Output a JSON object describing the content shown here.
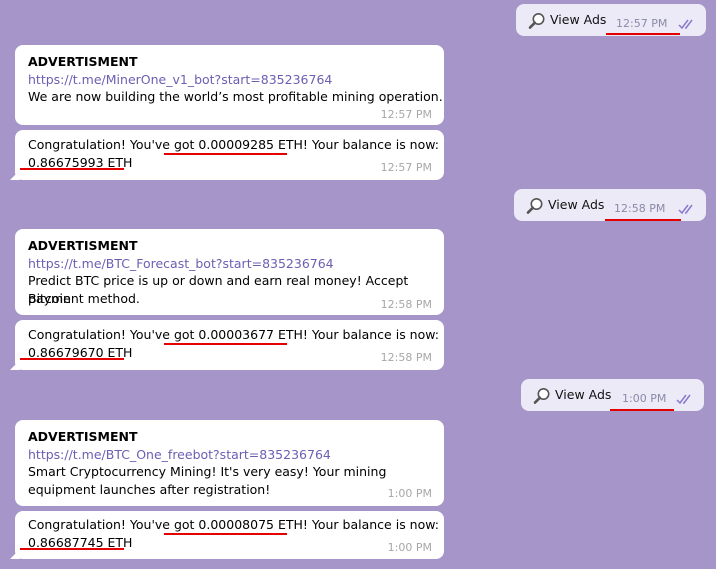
{
  "outgoing": [
    {
      "label": "View Ads",
      "time": "12:57 PM"
    },
    {
      "label": "View Ads",
      "time": "12:58 PM"
    },
    {
      "label": "View Ads",
      "time": "1:00 PM"
    }
  ],
  "ads": [
    {
      "title": "ADVERTISMENT",
      "link": "https://t.me/MinerOne_v1_bot?start=835236764",
      "line1": "We are now building the world’s most profitable mining operation.",
      "line2": "",
      "time": "12:57 PM"
    },
    {
      "title": "ADVERTISMENT",
      "link": "https://t.me/BTC_Forecast_bot?start=835236764",
      "line1": "Predict BTC price is up or down and earn real money! Accept Bitcoin",
      "line2": "payment method.",
      "time": "12:58 PM"
    },
    {
      "title": "ADVERTISMENT",
      "link": "https://t.me/BTC_One_freebot?start=835236764",
      "line1": "Smart Cryptocurrency Mining! It's very easy! Your mining",
      "line2": "equipment launches after registration!",
      "time": "1:00 PM"
    }
  ],
  "rewards": [
    {
      "pre": "Congratulation! You've ",
      "got": "got 0.00009285 ETH!",
      "mid": " Your balance is now:",
      "balance": "0.86675993 ETH",
      "time": "12:57 PM"
    },
    {
      "pre": "Congratulation! You've ",
      "got": "got 0.00003677 ETH!",
      "mid": " Your balance is now:",
      "balance": "0.86679670 ETH",
      "time": "12:58 PM"
    },
    {
      "pre": "Congratulation! You've ",
      "got": "got 0.00008075 ETH!",
      "mid": " Your balance is now:",
      "balance": "0.86687745 ETH",
      "time": "1:00 PM"
    }
  ],
  "colors": {
    "background": "#a595c8",
    "link": "#6b5fb3",
    "underline": "#e50000"
  }
}
